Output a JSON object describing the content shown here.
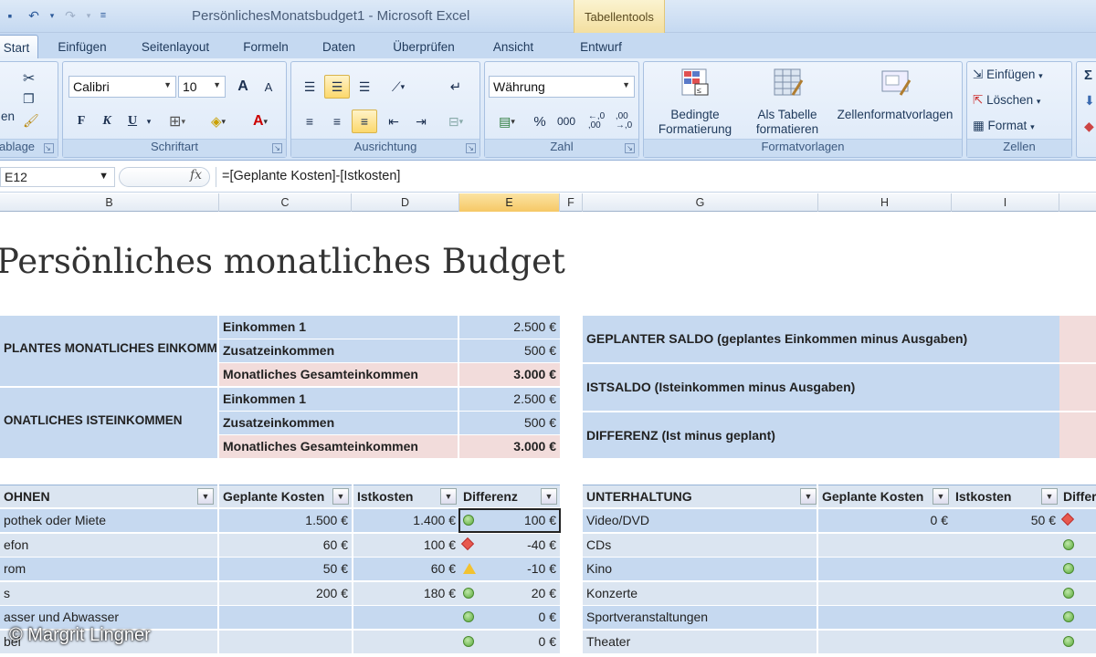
{
  "window": {
    "title": "PersönlichesMonatsbudget1 - Microsoft Excel",
    "context_tab": "Tabellentools"
  },
  "tabs": [
    "Start",
    "Einfügen",
    "Seitenlayout",
    "Formeln",
    "Daten",
    "Überprüfen",
    "Ansicht",
    "Entwurf"
  ],
  "ribbon": {
    "clipboard": {
      "paste_label": "en",
      "group": "ablage"
    },
    "font": {
      "name": "Calibri",
      "size": "10",
      "bold": "F",
      "italic": "K",
      "underline": "U",
      "grow": "A",
      "shrink": "A",
      "group": "Schriftart"
    },
    "alignment": {
      "group": "Ausrichtung"
    },
    "number": {
      "format": "Währung",
      "percent": "%",
      "thousands": "000",
      "group": "Zahl"
    },
    "styles": {
      "conditional": "Bedingte Formatierung",
      "as_table": "Als Tabelle formatieren",
      "cell_styles": "Zellenformatvorlagen",
      "group": "Formatvorlagen"
    },
    "cells": {
      "insert": "Einfügen",
      "delete": "Löschen",
      "format": "Format",
      "group": "Zellen"
    }
  },
  "formula_bar": {
    "name_box": "E12",
    "fx": "fx",
    "formula": "=[Geplante Kosten]-[Istkosten]"
  },
  "columns": [
    "B",
    "C",
    "D",
    "E",
    "F",
    "G",
    "H",
    "I"
  ],
  "sheet": {
    "title": "Persönliches monatliches Budget",
    "planned_income": {
      "label": "PLANTES MONATLICHES EINKOMMEN",
      "rows": [
        {
          "label": "Einkommen 1",
          "value": "2.500 €"
        },
        {
          "label": "Zusatzeinkommen",
          "value": "500 €"
        },
        {
          "label": "Monatliches Gesamteinkommen",
          "value": "3.000 €"
        }
      ]
    },
    "actual_income": {
      "label": "ONATLICHES ISTEINKOMMEN",
      "rows": [
        {
          "label": "Einkommen 1",
          "value": "2.500 €"
        },
        {
          "label": "Zusatzeinkommen",
          "value": "500 €"
        },
        {
          "label": "Monatliches Gesamteinkommen",
          "value": "3.000 €"
        }
      ]
    },
    "balance": [
      "GEPLANTER SALDO (geplantes Einkommen minus Ausgaben)",
      "ISTSALDO (Isteinkommen minus Ausgaben)",
      "DIFFERENZ (Ist minus geplant)"
    ],
    "housing": {
      "headers": [
        "OHNEN",
        "Geplante Kosten",
        "Istkosten",
        "Differenz"
      ],
      "rows": [
        {
          "name": "pothek oder Miete",
          "planned": "1.500 €",
          "actual": "1.400 €",
          "status": "green",
          "diff": "100 €"
        },
        {
          "name": "efon",
          "planned": "60 €",
          "actual": "100 €",
          "status": "red",
          "diff": "-40 €"
        },
        {
          "name": "rom",
          "planned": "50 €",
          "actual": "60 €",
          "status": "yellow",
          "diff": "-10 €"
        },
        {
          "name": "s",
          "planned": "200 €",
          "actual": "180 €",
          "status": "green",
          "diff": "20 €"
        },
        {
          "name": "asser und Abwasser",
          "planned": "",
          "actual": "",
          "status": "green",
          "diff": "0 €"
        },
        {
          "name": "bel",
          "planned": "",
          "actual": "",
          "status": "green",
          "diff": "0 €"
        }
      ]
    },
    "entertainment": {
      "headers": [
        "UNTERHALTUNG",
        "Geplante Kosten",
        "Istkosten",
        "Differ"
      ],
      "rows": [
        {
          "name": "Video/DVD",
          "planned": "0 €",
          "actual": "50 €",
          "status": "red"
        },
        {
          "name": "CDs",
          "planned": "",
          "actual": "",
          "status": "green"
        },
        {
          "name": "Kino",
          "planned": "",
          "actual": "",
          "status": "green"
        },
        {
          "name": "Konzerte",
          "planned": "",
          "actual": "",
          "status": "green"
        },
        {
          "name": "Sportveranstaltungen",
          "planned": "",
          "actual": "",
          "status": "green"
        },
        {
          "name": "Theater",
          "planned": "",
          "actual": "",
          "status": "green"
        }
      ]
    }
  },
  "watermark": "© Margrit Lingner",
  "colors": {
    "blue_band": "#c6d9f0",
    "light_band": "#dbe5f1",
    "pink_total": "#f2dcdb",
    "selected_header": "#f6c865"
  }
}
